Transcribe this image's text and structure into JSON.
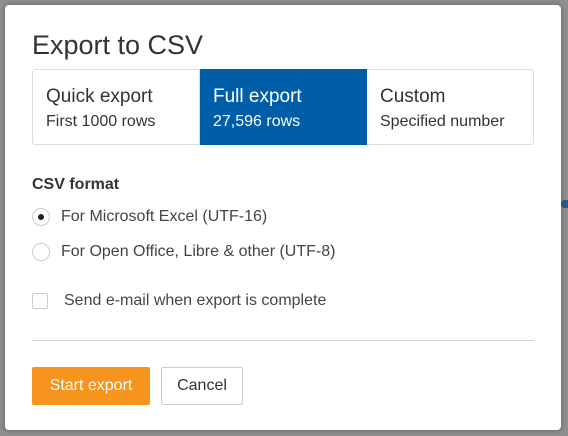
{
  "dialog": {
    "title": "Export to CSV",
    "tabs": [
      {
        "title": "Quick export",
        "subtitle": "First 1000 rows",
        "selected": false
      },
      {
        "title": "Full export",
        "subtitle": "27,596 rows",
        "selected": true
      },
      {
        "title": "Custom",
        "subtitle": "Specified number",
        "selected": false
      }
    ],
    "format_label": "CSV format",
    "format_options": [
      {
        "label": "For Microsoft Excel (UTF-16)",
        "checked": true
      },
      {
        "label": "For Open Office, Libre & other (UTF-8)",
        "checked": false
      }
    ],
    "email_option": {
      "label": "Send e-mail when export is complete",
      "checked": false
    },
    "buttons": {
      "start": "Start export",
      "cancel": "Cancel"
    }
  },
  "colors": {
    "selected_tab": "#005ea8",
    "primary_button": "#f7941d",
    "backdrop": "#8f8f8f"
  }
}
